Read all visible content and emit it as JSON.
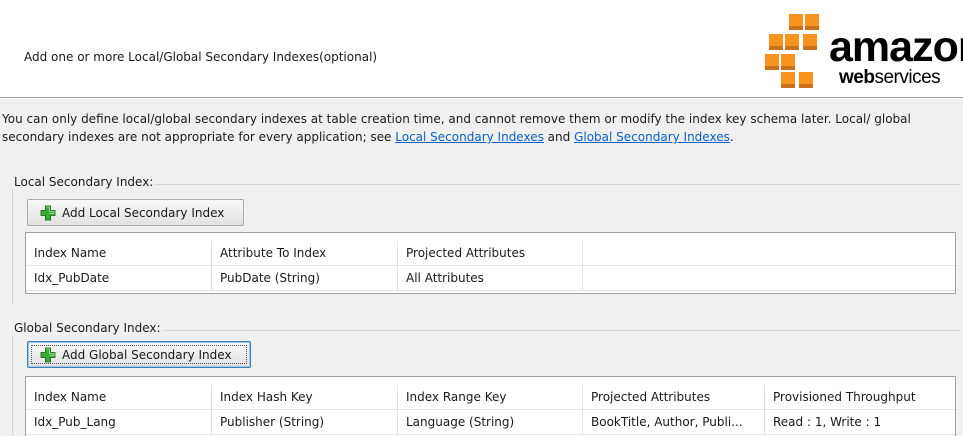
{
  "header": {
    "title": "Add one or more Local/Global Secondary Indexes(optional)",
    "logo": {
      "word": "amazon",
      "sub_bold": "web",
      "sub_light": "services",
      "brand_color": "#F7931E"
    }
  },
  "info": {
    "text_before": "You can only define local/global secondary indexes at table creation time, and cannot remove them or modify the index key schema later. Local/ global secondary indexes are not appropriate for every application; see ",
    "link_local": "Local Secondary Indexes",
    "text_and": " and ",
    "link_global": "Global Secondary Indexes",
    "text_end": "."
  },
  "local": {
    "group_label": "Local Secondary Index:",
    "add_button": "Add Local Secondary Index",
    "columns": [
      "Index Name",
      "Attribute To Index",
      "Projected Attributes",
      ""
    ],
    "rows": [
      [
        "Idx_PubDate",
        "PubDate (String)",
        "All Attributes",
        ""
      ]
    ]
  },
  "global": {
    "group_label": "Global Secondary Index:",
    "add_button": "Add Global Secondary Index",
    "columns": [
      "Index Name",
      "Index Hash Key",
      "Index Range Key",
      "Projected Attributes",
      "Provisioned Throughput"
    ],
    "rows": [
      [
        "Idx_Pub_Lang",
        "Publisher (String)",
        "Language (String)",
        "BookTitle, Author, Publi...",
        "Read : 1, Write : 1"
      ]
    ]
  },
  "icons": {
    "add": "green-plus-icon",
    "logo": "aws-logo-icon"
  },
  "colors": {
    "link": "#0B5FC4",
    "plus_green": "#3BAA35",
    "panel_bg": "#F0F0F0"
  }
}
